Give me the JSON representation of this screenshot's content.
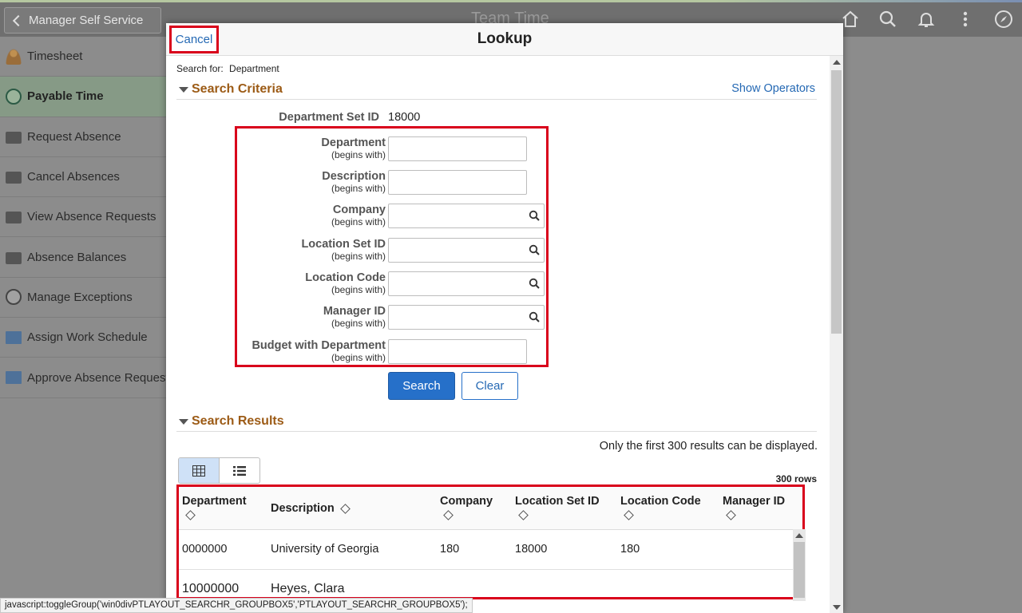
{
  "header": {
    "back_label": "Manager Self Service",
    "page_title": "Team Time"
  },
  "sidebar": {
    "items": [
      {
        "label": "Timesheet"
      },
      {
        "label": "Payable Time"
      },
      {
        "label": "Request Absence"
      },
      {
        "label": "Cancel Absences"
      },
      {
        "label": "View Absence Requests"
      },
      {
        "label": "Absence Balances"
      },
      {
        "label": "Manage Exceptions"
      },
      {
        "label": "Assign Work Schedule"
      },
      {
        "label": "Approve Absence Requests"
      }
    ],
    "active_index": 1
  },
  "modal": {
    "cancel_label": "Cancel",
    "title": "Lookup",
    "search_for_label": "Search for:",
    "search_for_value": "Department",
    "criteria_header": "Search Criteria",
    "show_operators": "Show Operators",
    "setid_label": "Department Set ID",
    "setid_value": "18000",
    "fields": [
      {
        "name": "Department",
        "op": "(begins with)",
        "value": ""
      },
      {
        "name": "Description",
        "op": "(begins with)",
        "value": ""
      },
      {
        "name": "Company",
        "op": "(begins with)",
        "value": ""
      },
      {
        "name": "Location Set ID",
        "op": "(begins with)",
        "value": ""
      },
      {
        "name": "Location Code",
        "op": "(begins with)",
        "value": ""
      },
      {
        "name": "Manager ID",
        "op": "(begins with)",
        "value": ""
      },
      {
        "name": "Budget with Department",
        "op": "(begins with)",
        "value": ""
      }
    ],
    "search_button": "Search",
    "clear_button": "Clear",
    "results_header": "Search Results",
    "results_note": "Only the first 300 results can be displayed.",
    "rows_count": "300 rows",
    "columns": [
      "Department",
      "Description",
      "Company",
      "Location Set ID",
      "Location Code",
      "Manager ID"
    ],
    "rows": [
      [
        "0000000",
        "University of Georgia",
        "180",
        "18000",
        "180",
        ""
      ],
      [
        "10000000",
        "Heyes, Clara",
        "",
        "",
        "",
        ""
      ]
    ]
  },
  "status_bar": "javascript:toggleGroup('win0divPTLAYOUT_SEARCHR_GROUPBOX5','PTLAYOUT_SEARCHR_GROUPBOX5');",
  "colors": {
    "accent_red": "#d9001b",
    "link_blue": "#2569b4",
    "section_orange": "#9c5b16",
    "primary_button": "#2670c9"
  }
}
